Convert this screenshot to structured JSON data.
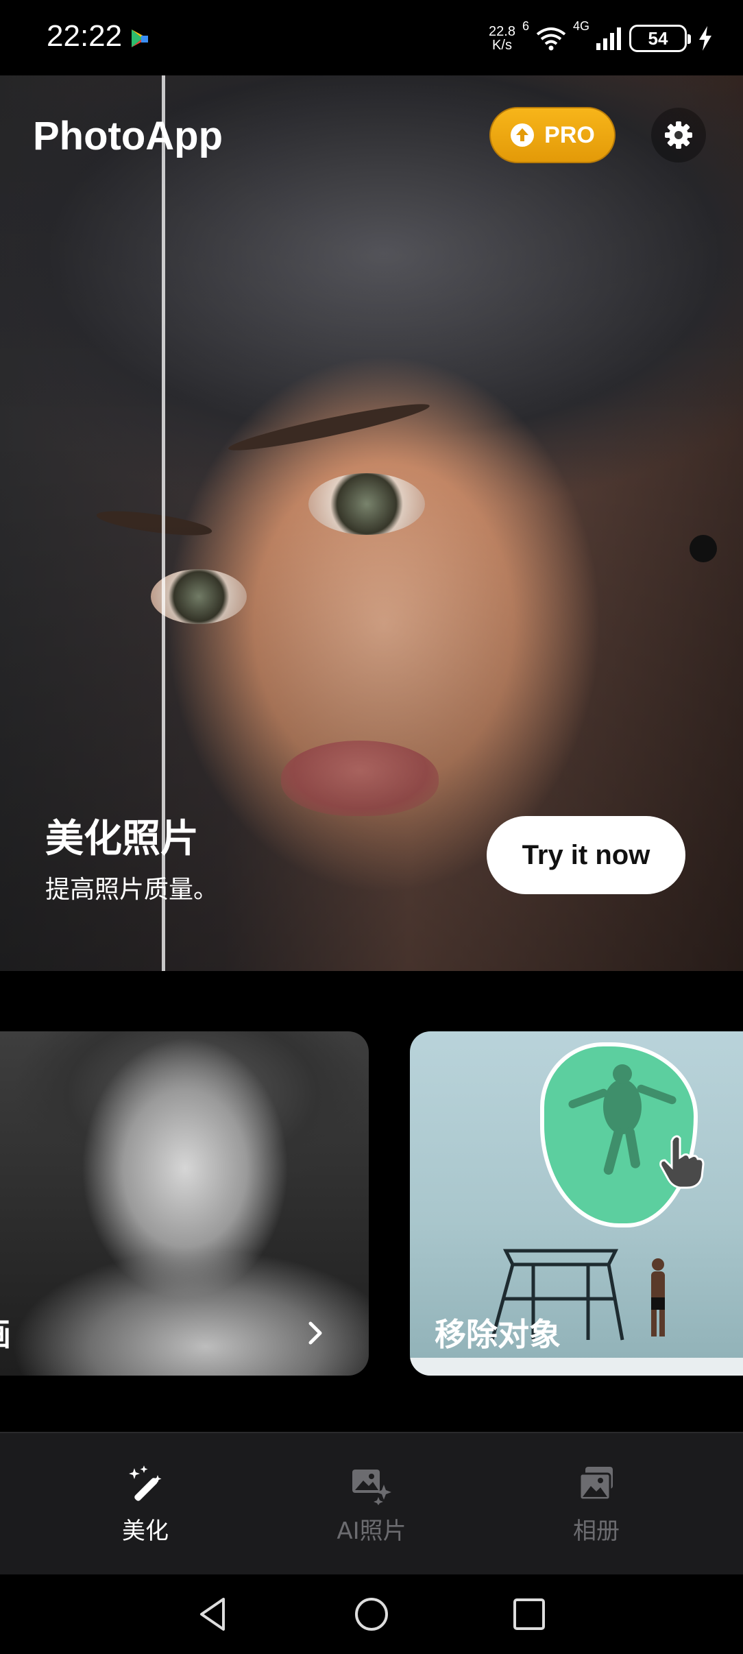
{
  "status_bar": {
    "time": "22:22",
    "net_speed_value": "22.8",
    "net_speed_unit": "K/s",
    "wifi_label": "6",
    "cell_label": "4G",
    "battery": "54"
  },
  "header": {
    "app_title": "PhotoApp",
    "pro_label": "PRO",
    "accent_color": "#F2A80F"
  },
  "hero": {
    "title": "美化照片",
    "subtitle": "提高照片质量。",
    "cta_label": "Try it now"
  },
  "cards": [
    {
      "label": "画"
    },
    {
      "label": "移除对象"
    }
  ],
  "bottom_nav": {
    "items": [
      {
        "label": "美化",
        "icon": "magic-wand-icon",
        "active": true
      },
      {
        "label": "AI照片",
        "icon": "ai-photo-icon",
        "active": false
      },
      {
        "label": "相册",
        "icon": "album-icon",
        "active": false
      }
    ]
  }
}
